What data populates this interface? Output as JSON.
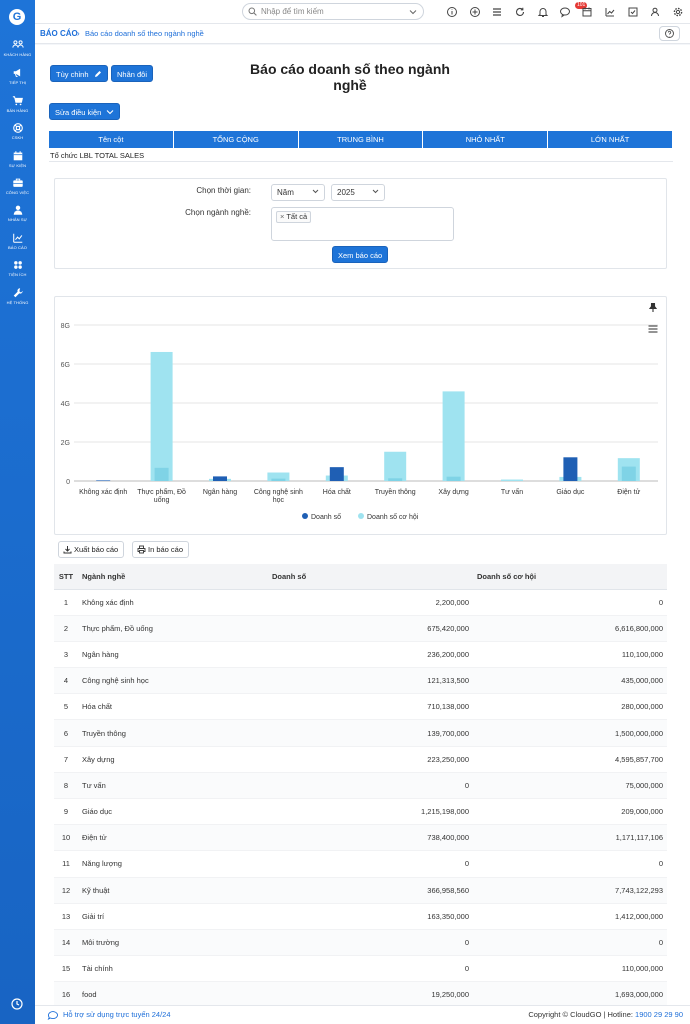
{
  "sidebar": {
    "logo": "G",
    "items": [
      {
        "label": "KHÁCH HÀNG",
        "icon": "customers-icon"
      },
      {
        "label": "TIẾP THỊ",
        "icon": "megaphone-icon"
      },
      {
        "label": "BÁN HÀNG",
        "icon": "cart-icon"
      },
      {
        "label": "CSKH",
        "icon": "support-icon"
      },
      {
        "label": "SỰ KIỆN",
        "icon": "calendar-icon"
      },
      {
        "label": "CÔNG VIỆC",
        "icon": "briefcase-icon"
      },
      {
        "label": "NHÂN SỰ",
        "icon": "person-icon"
      },
      {
        "label": "BÁO CÁO",
        "icon": "chart-icon"
      },
      {
        "label": "TIỆN ÍCH",
        "icon": "apps-icon"
      },
      {
        "label": "HỆ THỐNG",
        "icon": "wrench-icon"
      }
    ]
  },
  "topbar": {
    "search_placeholder": "Nhập để tìm kiếm",
    "notification_count": "101"
  },
  "breadcrumb": {
    "root": "BÁO CÁO",
    "separator": "›",
    "current": "Báo cáo doanh số theo ngành nghề"
  },
  "toolbar": {
    "customize_label": "Tùy chỉnh",
    "duplicate_label": "Nhân đôi",
    "edit_condition_label": "Sửa điều kiện"
  },
  "page_title": "Báo cáo doanh số theo ngành nghề",
  "summary": {
    "headers": [
      "Tên cột",
      "TỔNG CỘNG",
      "TRUNG BÌNH",
      "NHỎ NHẤT",
      "LỚN NHẤT"
    ],
    "row_label": "Tổ chức LBL TOTAL SALES"
  },
  "filters": {
    "time_label": "Chọn thời gian:",
    "time_period": "Năm",
    "time_year": "2025",
    "industry_label": "Chọn ngành nghề:",
    "industry_tag": "Tất cả",
    "view_button": "Xem báo cáo"
  },
  "chart_data": {
    "type": "bar",
    "categories": [
      "Không xác định",
      "Thực phẩm, Đồ uống",
      "Ngân hàng",
      "Công nghệ sinh học",
      "Hóa chất",
      "Truyền thông",
      "Xây dựng",
      "Tư vấn",
      "Giáo dục",
      "Điện tử"
    ],
    "series": [
      {
        "name": "Doanh số",
        "color": "#1f5fb4",
        "values": [
          2200000,
          675420000,
          236200000,
          121313500,
          710138000,
          139700000,
          223250000,
          0,
          1215198000,
          738400000
        ]
      },
      {
        "name": "Doanh số cơ hội",
        "color": "#9fe3f0",
        "values": [
          0,
          6616800000,
          110100000,
          435000000,
          280000000,
          1500000000,
          4595857700,
          75000000,
          209000000,
          1171117106
        ]
      }
    ],
    "yticks": [
      "0",
      "2G",
      "4G",
      "6G",
      "8G"
    ],
    "ylim": [
      0,
      8000000000
    ],
    "grid": true,
    "legend": "bottom"
  },
  "actions": {
    "export_label": "Xuất báo cáo",
    "print_label": "In báo cáo"
  },
  "table": {
    "headers": [
      "STT",
      "Ngành nghề",
      "Doanh số",
      "Doanh số cơ hội"
    ],
    "rows": [
      {
        "stt": "1",
        "name": "Không xác định",
        "sales": "2,200,000",
        "opp": "0"
      },
      {
        "stt": "2",
        "name": "Thực phẩm, Đồ uống",
        "sales": "675,420,000",
        "opp": "6,616,800,000"
      },
      {
        "stt": "3",
        "name": "Ngân hàng",
        "sales": "236,200,000",
        "opp": "110,100,000"
      },
      {
        "stt": "4",
        "name": "Công nghệ sinh học",
        "sales": "121,313,500",
        "opp": "435,000,000"
      },
      {
        "stt": "5",
        "name": "Hóa chất",
        "sales": "710,138,000",
        "opp": "280,000,000"
      },
      {
        "stt": "6",
        "name": "Truyền thông",
        "sales": "139,700,000",
        "opp": "1,500,000,000"
      },
      {
        "stt": "7",
        "name": "Xây dựng",
        "sales": "223,250,000",
        "opp": "4,595,857,700"
      },
      {
        "stt": "8",
        "name": "Tư vấn",
        "sales": "0",
        "opp": "75,000,000"
      },
      {
        "stt": "9",
        "name": "Giáo dục",
        "sales": "1,215,198,000",
        "opp": "209,000,000"
      },
      {
        "stt": "10",
        "name": "Điện tử",
        "sales": "738,400,000",
        "opp": "1,171,117,106"
      },
      {
        "stt": "11",
        "name": "Năng lượng",
        "sales": "0",
        "opp": "0"
      },
      {
        "stt": "12",
        "name": "Kỹ thuật",
        "sales": "366,958,560",
        "opp": "7,743,122,293"
      },
      {
        "stt": "13",
        "name": "Giải trí",
        "sales": "163,350,000",
        "opp": "1,412,000,000"
      },
      {
        "stt": "14",
        "name": "Môi trường",
        "sales": "0",
        "opp": "0"
      },
      {
        "stt": "15",
        "name": "Tài chính",
        "sales": "0",
        "opp": "110,000,000"
      },
      {
        "stt": "16",
        "name": "food",
        "sales": "19,250,000",
        "opp": "1,693,000,000"
      }
    ]
  },
  "footer": {
    "support_text": "Hỗ trợ sử dụng trực tuyến 24/24",
    "copyright": "Copyright © CloudGO | Hotline: ",
    "hotline": "1900 29 29 90"
  }
}
